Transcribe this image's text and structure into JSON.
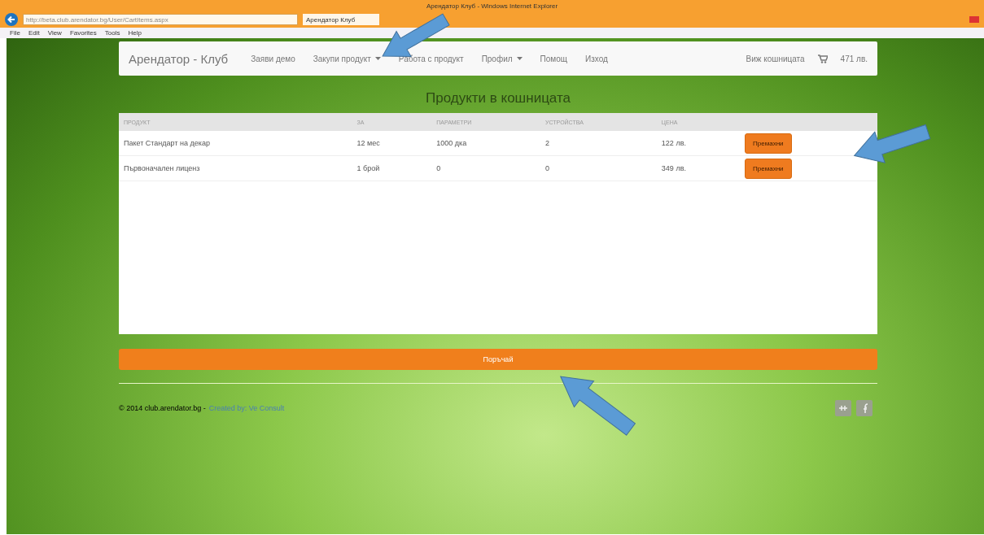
{
  "browser": {
    "title": "Арендатор Клуб - Windows Internet Explorer",
    "url": "http://beta.club.arendator.bg/User/CartItems.aspx",
    "tab": "Арендатор Клуб",
    "menu": [
      "File",
      "Edit",
      "View",
      "Favorites",
      "Tools",
      "Help"
    ]
  },
  "navbar": {
    "brand": "Арендатор - Клуб",
    "items": [
      {
        "label": "Заяви демо",
        "dropdown": false
      },
      {
        "label": "Закупи продукт",
        "dropdown": true
      },
      {
        "label": "Работа с продукт",
        "dropdown": false
      },
      {
        "label": "Профил",
        "dropdown": true
      },
      {
        "label": "Помощ",
        "dropdown": false
      },
      {
        "label": "Изход",
        "dropdown": false
      }
    ],
    "cart_label": "Виж кошницата",
    "cart_total": "471 лв."
  },
  "heading": "Продукти в кошницата",
  "table": {
    "columns": [
      "ПРОДУКТ",
      "ЗА",
      "ПАРАМЕТРИ",
      "УСТРОЙСТВА",
      "ЦЕНА"
    ],
    "rows": [
      {
        "cells": [
          "Пакет Стандарт на декар",
          "12 мес",
          "1000 дка",
          "2",
          "122 лв."
        ],
        "action": "Премахни"
      },
      {
        "cells": [
          "Първоначален лиценз",
          "1 брой",
          "0",
          "0",
          "349 лв."
        ],
        "action": "Премахни"
      }
    ]
  },
  "order_button": "Поръчай",
  "footer": {
    "copyright": "© 2014 club.arendator.bg -",
    "credit": "Created by: Ve Consult"
  }
}
